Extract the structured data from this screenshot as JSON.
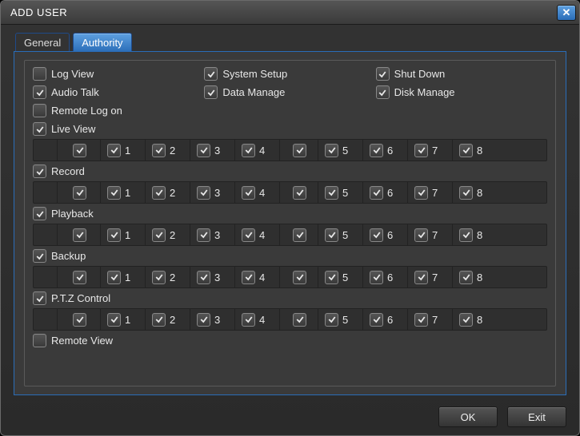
{
  "window": {
    "title": "ADD USER",
    "close_glyph": "✕"
  },
  "tabs": {
    "general": "General",
    "authority": "Authority"
  },
  "options": {
    "log_view": {
      "label": "Log View",
      "checked": false
    },
    "system_setup": {
      "label": "System Setup",
      "checked": true
    },
    "shut_down": {
      "label": "Shut Down",
      "checked": true
    },
    "audio_talk": {
      "label": "Audio Talk",
      "checked": true
    },
    "data_manage": {
      "label": "Data Manage",
      "checked": true
    },
    "disk_manage": {
      "label": "Disk Manage",
      "checked": true
    },
    "remote_log_on": {
      "label": "Remote Log on",
      "checked": false
    },
    "live_view": {
      "label": "Live View",
      "checked": true
    },
    "record": {
      "label": "Record",
      "checked": true
    },
    "playback": {
      "label": "Playback",
      "checked": true
    },
    "backup": {
      "label": "Backup",
      "checked": true
    },
    "ptz_control": {
      "label": "P.T.Z Control",
      "checked": true
    },
    "remote_view": {
      "label": "Remote View",
      "checked": false
    }
  },
  "channel_labels": [
    "1",
    "2",
    "3",
    "4",
    "5",
    "6",
    "7",
    "8"
  ],
  "channel_groups": {
    "live_view": {
      "all": true,
      "ch": [
        true,
        true,
        true,
        true,
        true,
        true,
        true,
        true
      ],
      "empty": true
    },
    "record": {
      "all": true,
      "ch": [
        true,
        true,
        true,
        true,
        true,
        true,
        true,
        true
      ],
      "empty": true
    },
    "playback": {
      "all": true,
      "ch": [
        true,
        true,
        true,
        true,
        true,
        true,
        true,
        true
      ],
      "empty": true
    },
    "backup": {
      "all": true,
      "ch": [
        true,
        true,
        true,
        true,
        true,
        true,
        true,
        true
      ],
      "empty": true
    },
    "ptz_control": {
      "all": true,
      "ch": [
        true,
        true,
        true,
        true,
        true,
        true,
        true,
        true
      ],
      "empty": true
    }
  },
  "buttons": {
    "ok": "OK",
    "exit": "Exit"
  }
}
